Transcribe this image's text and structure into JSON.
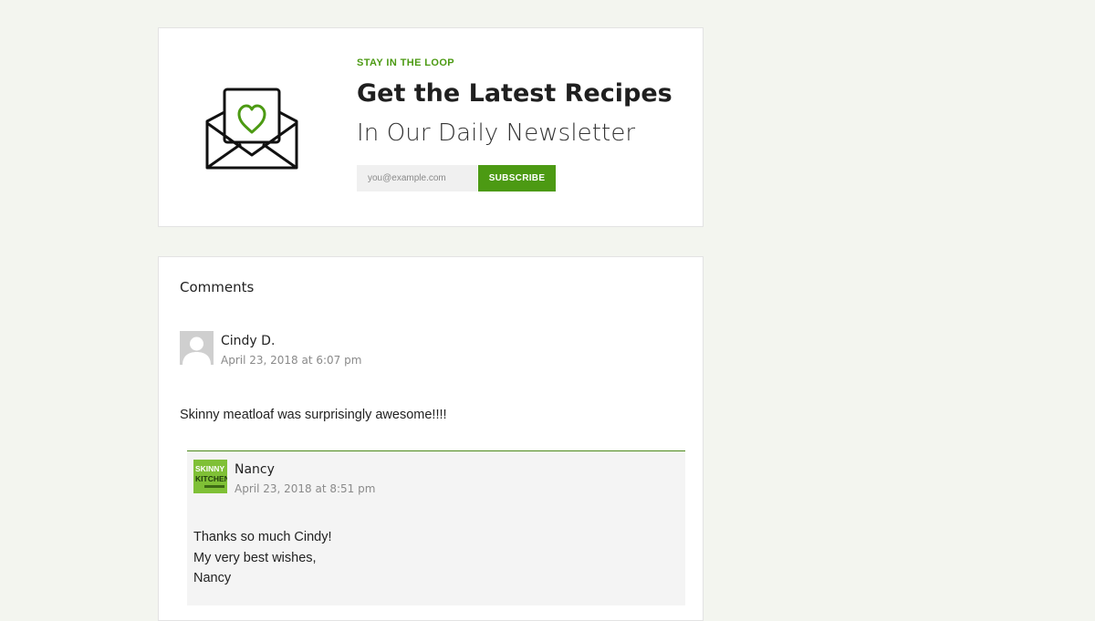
{
  "colors": {
    "accent": "#4c9a13",
    "page_background": "#f3f5ef",
    "reply_border": "#4c8a1a",
    "reply_background": "#f4f4f4"
  },
  "newsletter": {
    "eyebrow": "STAY IN THE LOOP",
    "title": "Get the Latest Recipes",
    "subtitle": "In Our Daily Newsletter",
    "email_placeholder": "you@example.com",
    "email_value": "",
    "subscribe_label": "SUBSCRIBE",
    "icon": "envelope-heart-icon"
  },
  "comments": {
    "heading": "Comments",
    "items": [
      {
        "author": "Cindy D.",
        "date": "April 23, 2018 at 6:07 pm",
        "avatar": "default-user-avatar",
        "text": "Skinny meatloaf was surprisingly awesome!!!!"
      }
    ],
    "reply": {
      "author": "Nancy",
      "date": "April 23, 2018 at 8:51 pm",
      "avatar": "skinny-kitchen-logo",
      "avatar_text": [
        "SKINNY",
        "KITCHEN"
      ],
      "lines": [
        "Thanks so much Cindy!",
        "My very best wishes,",
        "Nancy"
      ]
    }
  }
}
